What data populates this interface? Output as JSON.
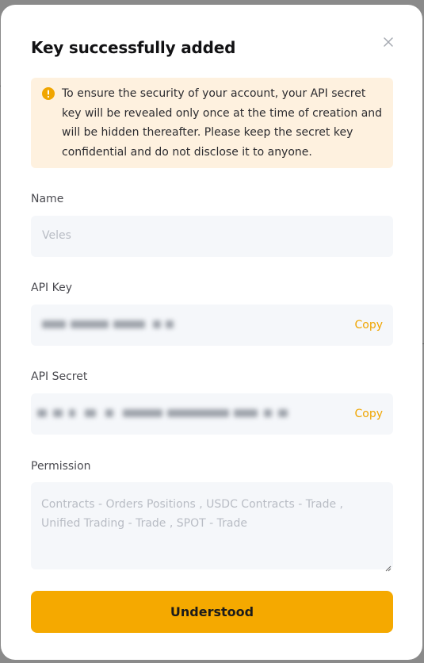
{
  "dialog": {
    "title": "Key successfully added",
    "notice": "To ensure the security of your account, your API secret key will be revealed only once at the time of creation and will be hidden thereafter. Please keep the secret key confidential and do not disclose it to anyone.",
    "icons": {
      "close": "close-icon",
      "warning": "warning-circle-icon"
    }
  },
  "fields": {
    "name": {
      "label": "Name",
      "value": "Veles"
    },
    "api_key": {
      "label": "API Key",
      "copy_label": "Copy"
    },
    "api_secret": {
      "label": "API Secret",
      "copy_label": "Copy"
    },
    "permission": {
      "label": "Permission",
      "value": "Contracts - Orders Positions  , USDC Contracts - Trade  ,\nUnified Trading - Trade  , SPOT - Trade"
    }
  },
  "actions": {
    "confirm_label": "Understood"
  },
  "colors": {
    "accent": "#f5a900",
    "notice_bg": "#fef1df",
    "field_bg": "#f5f7fa"
  }
}
